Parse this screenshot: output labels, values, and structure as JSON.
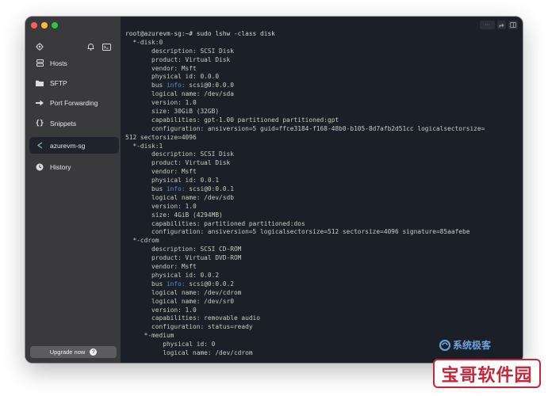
{
  "sidebar": {
    "items": [
      {
        "id": "hosts",
        "label": "Hosts",
        "icon": "hosts-icon"
      },
      {
        "id": "sftp",
        "label": "SFTP",
        "icon": "folder-icon"
      },
      {
        "id": "port-forwarding",
        "label": "Port Forwarding",
        "icon": "arrow-right-icon"
      },
      {
        "id": "snippets",
        "label": "Snippets",
        "icon": "braces-icon"
      },
      {
        "id": "session",
        "label": "azurevm-sg",
        "icon": "terminal-session-icon",
        "active": true
      },
      {
        "id": "history",
        "label": "History",
        "icon": "clock-icon"
      }
    ],
    "upgrade_label": "Upgrade now",
    "upgrade_help": "?"
  },
  "terminal": {
    "lines": [
      "root@azurevm-sg:~# sudo lshw -class disk",
      "  *-disk:0",
      "       description: SCSI Disk",
      "       product: Virtual Disk",
      "       vendor: Msft",
      "       physical id: 0.0.0",
      "       bus info: scsi@0:0.0.0",
      "       logical name: /dev/sda",
      "       version: 1.0",
      "       size: 30GiB (32GB)",
      "       capabilities: gpt-1.00 partitioned partitioned:gpt",
      "       configuration: ansiversion=5 guid=ffce3184-f168-48b0-b105-8d7afb2d51cc logicalsectorsize=",
      "512 sectorsize=4096",
      "  *-disk:1",
      "       description: SCSI Disk",
      "       product: Virtual Disk",
      "       vendor: Msft",
      "       physical id: 0.0.1",
      "       bus info: scsi@0:0.0.1",
      "       logical name: /dev/sdb",
      "       version: 1.0",
      "       size: 4GiB (4294MB)",
      "       capabilities: partitioned partitioned:dos",
      "       configuration: ansiversion=5 logicalsectorsize=512 sectorsize=4096 signature=85aafebe",
      "  *-cdrom",
      "       description: SCSI CD-ROM",
      "       product: Virtual DVD-ROM",
      "       vendor: Msft",
      "       physical id: 0.0.2",
      "       bus info: scsi@0:0.0.2",
      "       logical name: /dev/cdrom",
      "       logical name: /dev/sr0",
      "       version: 1.0",
      "       capabilities: removable audio",
      "       configuration: status=ready",
      "     *-medium",
      "          physical id: 0",
      "          logical name: /dev/cdrom"
    ]
  },
  "watermarks": {
    "blue_text": "系统极客",
    "stamp_text": "宝哥软件园"
  },
  "colors": {
    "sidebar_bg": "#3a3a3d",
    "terminal_bg": "#1b1f27",
    "terminal_text": "#c4d0bd",
    "bus_info_blue": "#5d8bd6",
    "active_item_bg": "#1f232b"
  }
}
